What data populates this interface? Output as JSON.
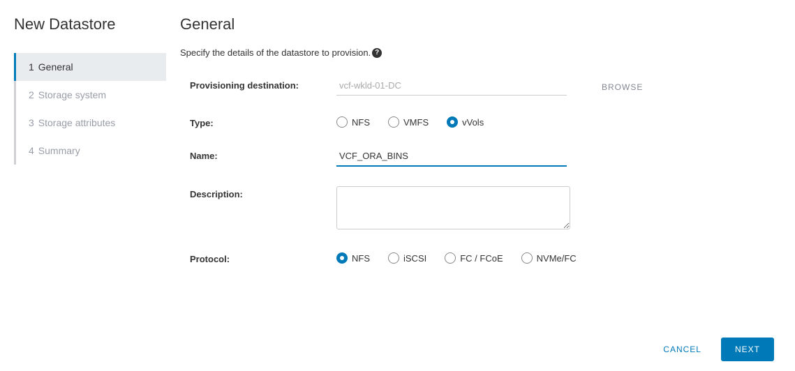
{
  "wizard": {
    "title": "New Datastore",
    "steps": [
      {
        "num": "1",
        "label": "General",
        "active": true
      },
      {
        "num": "2",
        "label": "Storage system",
        "active": false
      },
      {
        "num": "3",
        "label": "Storage attributes",
        "active": false
      },
      {
        "num": "4",
        "label": "Summary",
        "active": false
      }
    ]
  },
  "page": {
    "title": "General",
    "subtitle": "Specify the details of the datastore to provision.",
    "help_glyph": "?"
  },
  "form": {
    "dest_label": "Provisioning destination:",
    "dest_value": "vcf-wkld-01-DC",
    "browse_label": "BROWSE",
    "type_label": "Type:",
    "type_options": [
      {
        "value": "nfs",
        "label": "NFS",
        "checked": false
      },
      {
        "value": "vmfs",
        "label": "VMFS",
        "checked": false
      },
      {
        "value": "vvols",
        "label": "vVols",
        "checked": true
      }
    ],
    "name_label": "Name:",
    "name_value": "VCF_ORA_BINS",
    "desc_label": "Description:",
    "desc_value": "",
    "protocol_label": "Protocol:",
    "protocol_options": [
      {
        "value": "nfs",
        "label": "NFS",
        "checked": true
      },
      {
        "value": "iscsi",
        "label": "iSCSI",
        "checked": false
      },
      {
        "value": "fc",
        "label": "FC / FCoE",
        "checked": false
      },
      {
        "value": "nvme",
        "label": "NVMe/FC",
        "checked": false
      }
    ]
  },
  "footer": {
    "cancel": "CANCEL",
    "next": "NEXT"
  }
}
